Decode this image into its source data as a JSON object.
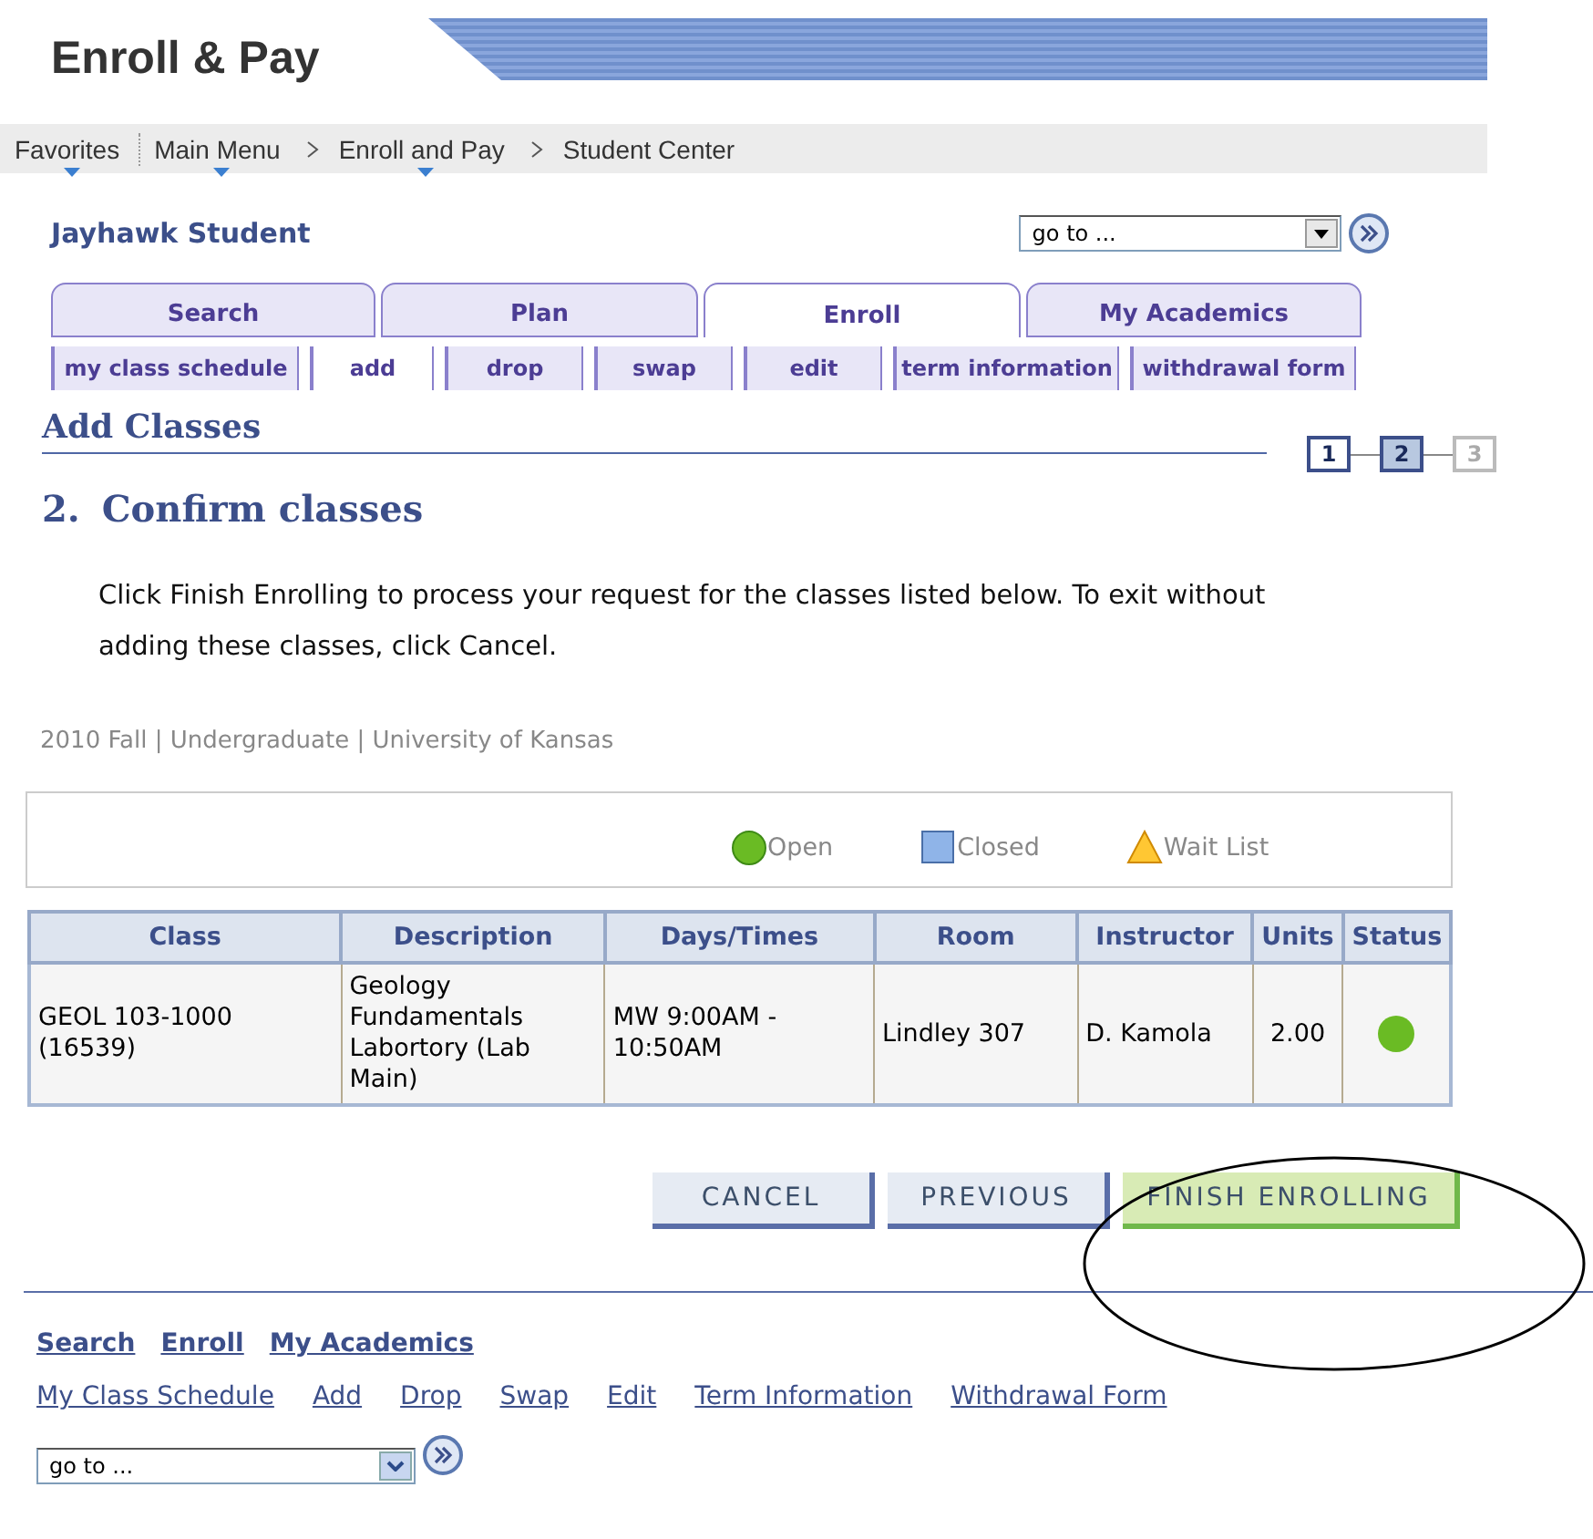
{
  "header": {
    "title": "Enroll & Pay"
  },
  "breadcrumbs": [
    {
      "label": "Favorites",
      "menu": true
    },
    {
      "label": "Main Menu",
      "menu": true
    },
    {
      "label": "Enroll and Pay",
      "menu": true
    },
    {
      "label": "Student Center",
      "menu": false
    }
  ],
  "student": {
    "name": "Jayhawk Student"
  },
  "goto_top": {
    "value": "go to ..."
  },
  "tabs": [
    {
      "label": "Search",
      "selected": false
    },
    {
      "label": "Plan",
      "selected": false
    },
    {
      "label": "Enroll",
      "selected": true
    },
    {
      "label": "My Academics",
      "selected": false
    }
  ],
  "subtabs": [
    {
      "label": "my class schedule",
      "selected": false
    },
    {
      "label": "add",
      "selected": true
    },
    {
      "label": "drop",
      "selected": false
    },
    {
      "label": "swap",
      "selected": false
    },
    {
      "label": "edit",
      "selected": false
    },
    {
      "label": "term information",
      "selected": false
    },
    {
      "label": "withdrawal form",
      "selected": false
    }
  ],
  "section_title": "Add Classes",
  "steps": [
    {
      "label": "1",
      "selected": false,
      "disabled": false
    },
    {
      "label": "2",
      "selected": true,
      "disabled": false
    },
    {
      "label": "3",
      "selected": false,
      "disabled": true
    }
  ],
  "step_title": {
    "number": "2.",
    "text": "Confirm classes"
  },
  "instructions": "Click Finish Enrolling to process your request for the classes listed below. To exit without adding these classes, click Cancel.",
  "term": "2010 Fall | Undergraduate | University of Kansas",
  "legend": [
    {
      "kind": "open",
      "label": "Open"
    },
    {
      "kind": "closed",
      "label": "Closed"
    },
    {
      "kind": "waitlist",
      "label": "Wait List"
    }
  ],
  "table": {
    "columns": [
      "Class",
      "Description",
      "Days/Times",
      "Room",
      "Instructor",
      "Units",
      "Status"
    ],
    "rows": [
      {
        "class": "GEOL 103-1000 (16539)",
        "description": "Geology Fundamentals Labortory (Lab Main)",
        "days_times": "MW 9:00AM - 10:50AM",
        "room": "Lindley 307",
        "instructor": "D. Kamola",
        "units": "2.00",
        "color": "#6abb24"
      }
    ]
  },
  "buttons": [
    {
      "label": "CANCEL",
      "primary": false
    },
    {
      "label": "PREVIOUS",
      "primary": false
    },
    {
      "label": "FINISH ENROLLING",
      "primary": true
    }
  ],
  "footer_tabs": [
    "Search",
    "Enroll",
    "My Academics"
  ],
  "footer_links": [
    "My Class Schedule",
    "Add",
    "Drop",
    "Swap",
    "Edit",
    "Term Information",
    "Withdrawal Form"
  ],
  "goto_bottom": {
    "value": "go to ..."
  },
  "annotation": {
    "kind": "ellipse"
  }
}
